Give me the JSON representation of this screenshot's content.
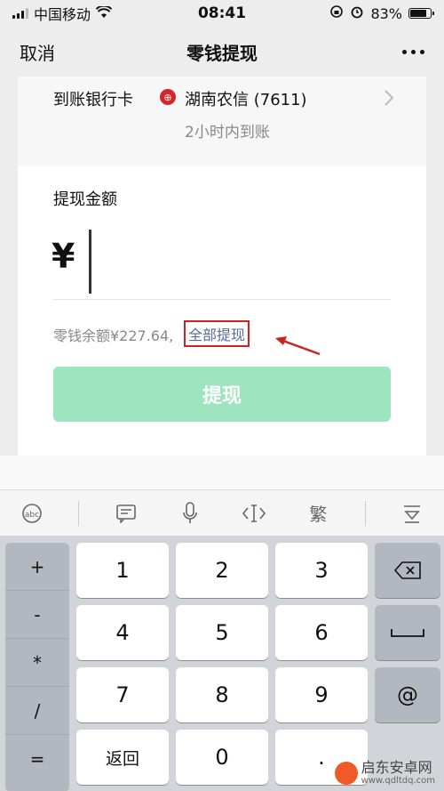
{
  "status_bar": {
    "carrier": "中国移动",
    "time": "08:41",
    "battery": "83%",
    "battery_level": 0.83
  },
  "nav": {
    "cancel": "取消",
    "title": "零钱提现"
  },
  "bank": {
    "label": "到账银行卡",
    "icon_glyph": "⊕",
    "name": "湖南农信 (7611)",
    "eta": "2小时内到账"
  },
  "form": {
    "amount_label": "提现金额",
    "currency": "¥",
    "balance": "零钱余额¥227.64,",
    "withdraw_all": "全部提现",
    "withdraw_button": "提现"
  },
  "toolbar": {
    "keyboard_icon": "㊧",
    "emoji_icon": "☰",
    "mic_icon": "🎤",
    "cursor_icon": "‹I›",
    "traditional": "繁",
    "hide_icon": "▽"
  },
  "keypad": {
    "side": [
      "+",
      "-",
      "*",
      "/",
      "="
    ],
    "digits": [
      "1",
      "2",
      "3",
      "4",
      "5",
      "6",
      "7",
      "8",
      "9"
    ],
    "back": "返回",
    "zero": "0",
    "dot": ".",
    "delete": "⌫",
    "space": "␣",
    "at": "@"
  },
  "watermark": {
    "name": "启东安卓网",
    "url": "www.qdltdq.com"
  },
  "colors": {
    "accent": "#576b95",
    "button_disabled": "#9de4bf",
    "highlight": "#d02020"
  }
}
